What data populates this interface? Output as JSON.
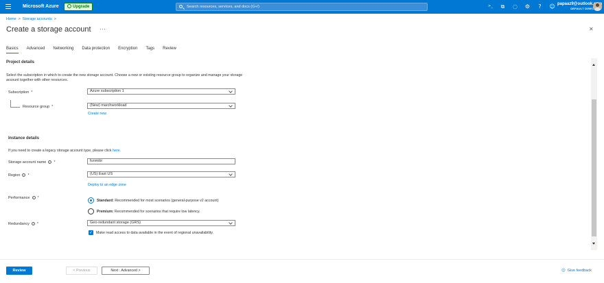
{
  "topbar": {
    "brand": "Microsoft Azure",
    "upgrade_label": "Upgrade",
    "search_placeholder": "Search resources, services, and docs (G+/)",
    "icons": [
      "cloud-shell-icon",
      "directory-filter-icon",
      "notifications-icon",
      "settings-icon",
      "help-icon",
      "feedback-icon"
    ],
    "icon_glyphs": [
      ">_",
      "⧉",
      "◌",
      "⚙",
      "?",
      "☺"
    ],
    "account_email": "papaaz9@outlook.com",
    "account_directory": "DEFAULT DIRECTORY"
  },
  "breadcrumb": {
    "items": [
      "Home",
      "Storage accounts"
    ],
    "trailing_sep": ">"
  },
  "page": {
    "title": "Create a storage account",
    "more_label": "···",
    "close_label": "✕"
  },
  "tabs": [
    "Basics",
    "Advanced",
    "Networking",
    "Data protection",
    "Encryption",
    "Tags",
    "Review"
  ],
  "active_tab": "Basics",
  "project": {
    "heading": "Project details",
    "description": "Select the subscription in which to create the new storage account. Choose a new or existing resource group to organize and manage your storage account together with other resources.",
    "subscription_label": "Subscription",
    "subscription_value": "Azure subscription 1",
    "resource_group_label": "Resource group",
    "resource_group_value": "(New) marchworkload",
    "create_new_link": "Create new",
    "required_mark": "*"
  },
  "instance": {
    "heading": "Instance details",
    "legacy_text": "If you need to create a legacy storage account type, please click ",
    "legacy_link": "here.",
    "name_label": "Storage account name",
    "name_value": "funmibi",
    "region_label": "Region",
    "region_value": "(US) East US",
    "edge_zone_link": "Deploy to an edge zone",
    "performance_label": "Performance",
    "performance_options": [
      {
        "title": "Standard:",
        "desc": " Recommended for most scenarios (general-purpose v2 account)",
        "selected": true
      },
      {
        "title": "Premium:",
        "desc": " Recommended for scenarios that require low latency.",
        "selected": false
      }
    ],
    "redundancy_label": "Redundancy",
    "redundancy_value": "Geo-redundant storage (GRS)",
    "read_access_label": "Make read access to data available in the event of regional unavailability.",
    "read_access_checked": true,
    "info_glyph": "i",
    "required_mark": "*"
  },
  "footer": {
    "review_label": "Review",
    "previous_label": "< Previous",
    "next_label": "Next : Advanced >",
    "feedback_label": "Give feedback"
  },
  "colors": {
    "accent": "#0078d4",
    "upgrade_green": "#107c10"
  }
}
